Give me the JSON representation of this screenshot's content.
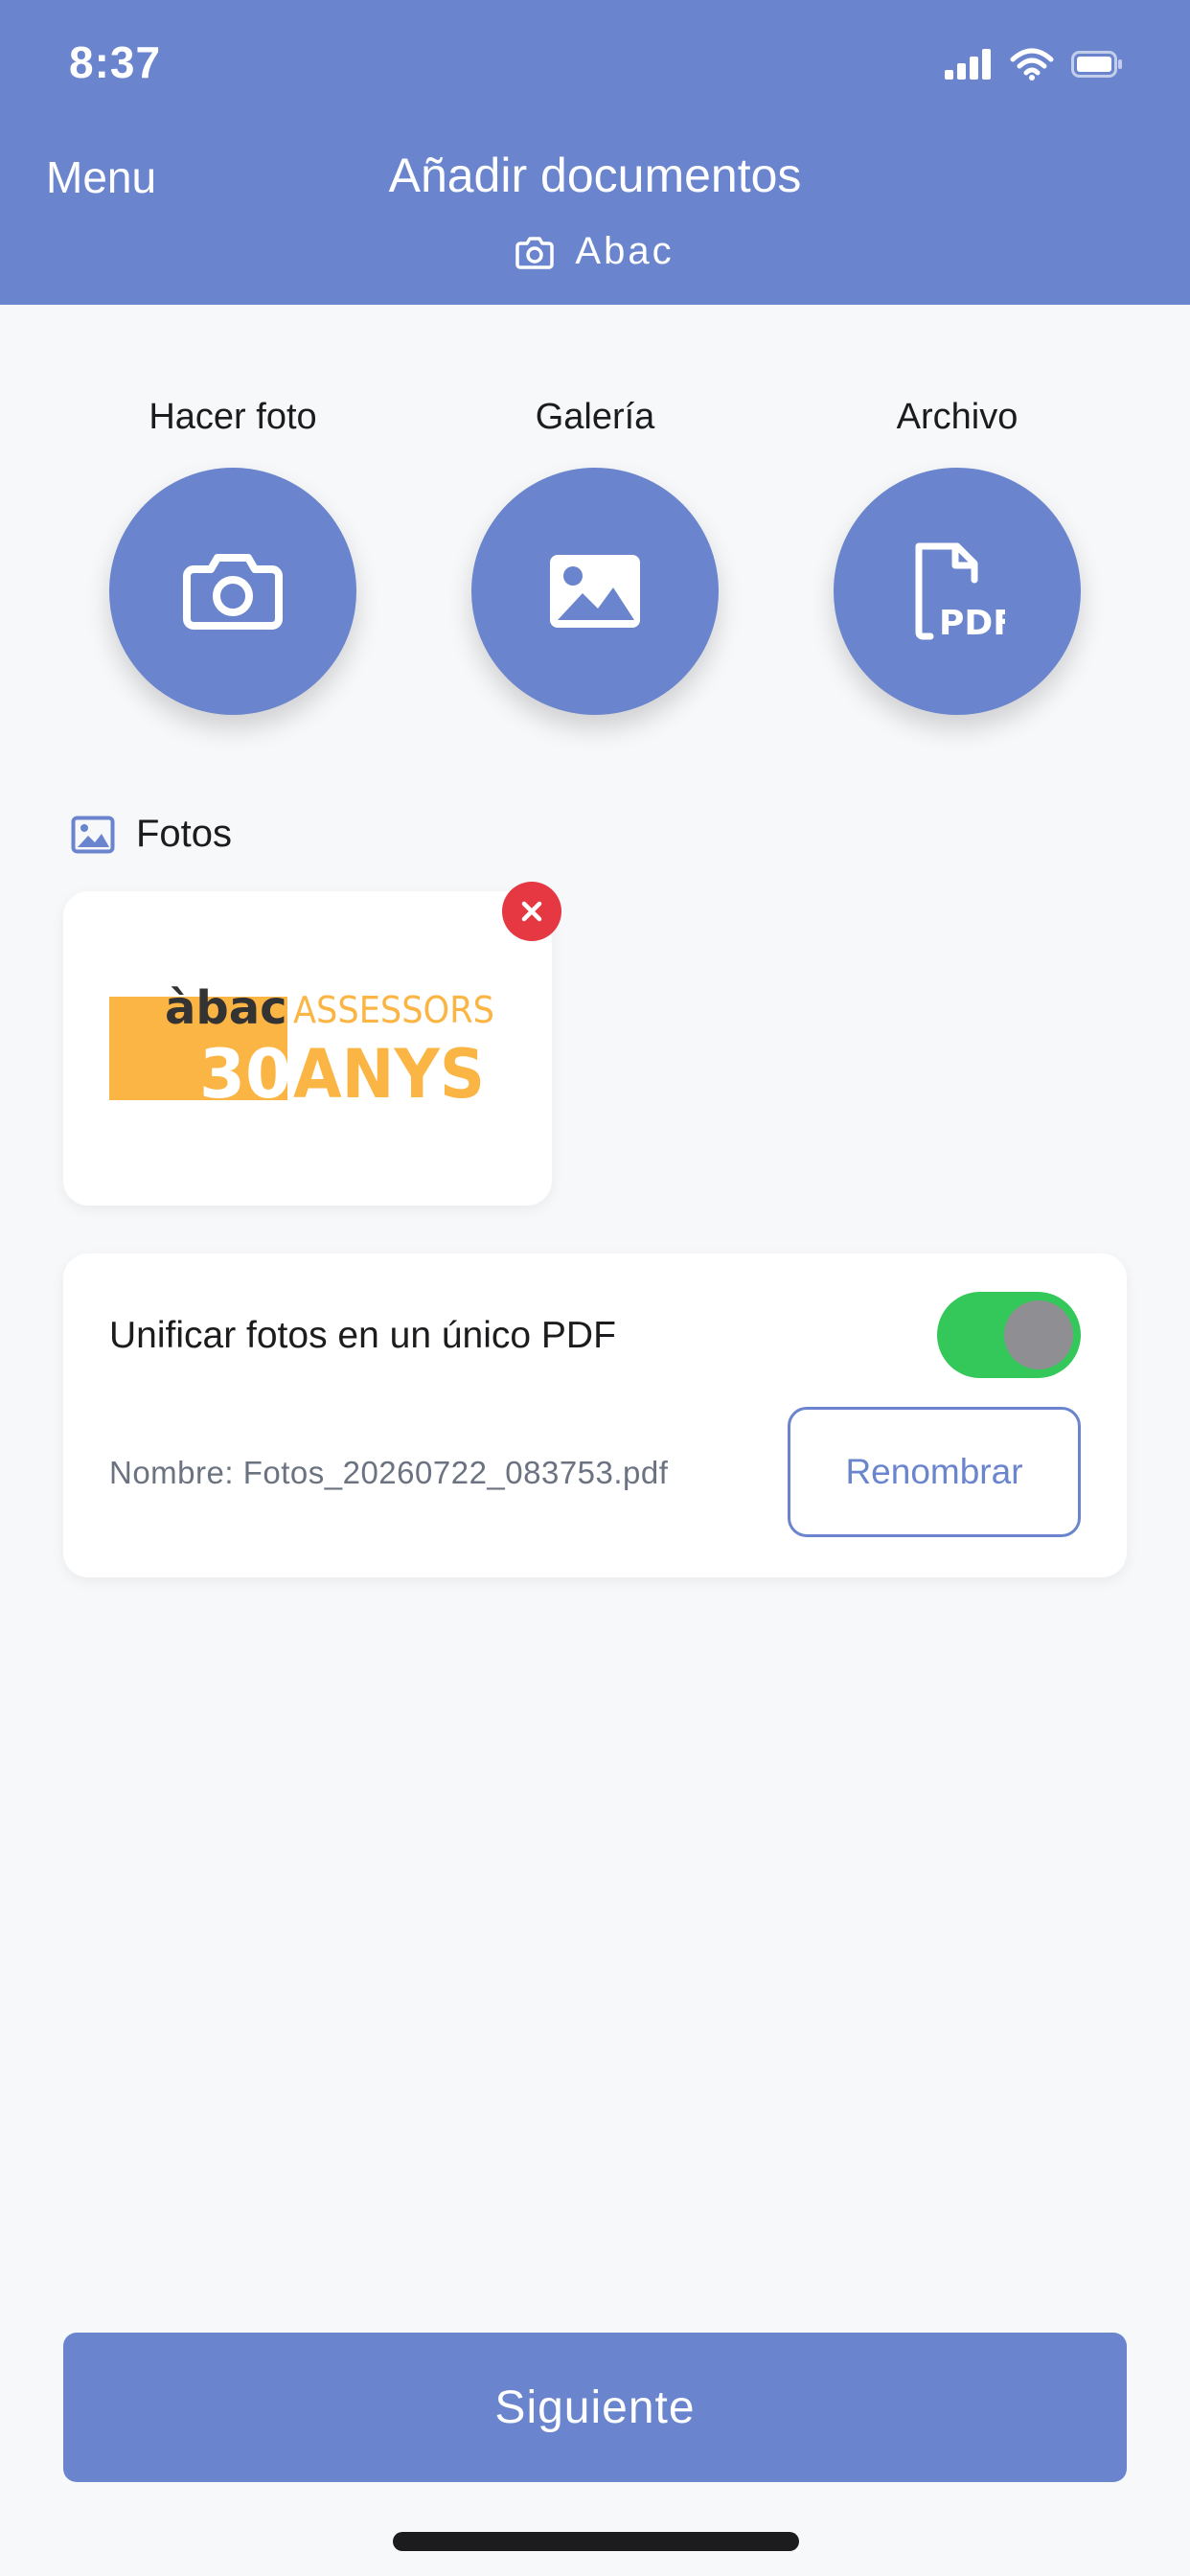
{
  "status_bar": {
    "time": "8:37"
  },
  "nav": {
    "menu_label": "Menu",
    "title": "Añadir documentos",
    "subtitle": "Abac"
  },
  "actions": [
    {
      "label": "Hacer foto",
      "icon": "camera-icon"
    },
    {
      "label": "Galería",
      "icon": "image-icon"
    },
    {
      "label": "Archivo",
      "icon": "pdf-file-icon"
    }
  ],
  "photos_section": {
    "title": "Fotos",
    "items": [
      {
        "logo_text_top": "àbac",
        "logo_text_assessors": "ASSESSORS",
        "logo_text_number": "30",
        "logo_text_anys": "ANYS"
      }
    ]
  },
  "unify": {
    "label": "Unificar fotos en un único PDF",
    "enabled": true,
    "name_text": "Nombre: Fotos_20260722_083753.pdf",
    "rename_label": "Renombrar"
  },
  "footer": {
    "next_label": "Siguiente"
  },
  "colors": {
    "primary": "#6a85cd",
    "toggle_on": "#34c759",
    "danger": "#e53843",
    "logo_yellow": "#fbb545"
  }
}
